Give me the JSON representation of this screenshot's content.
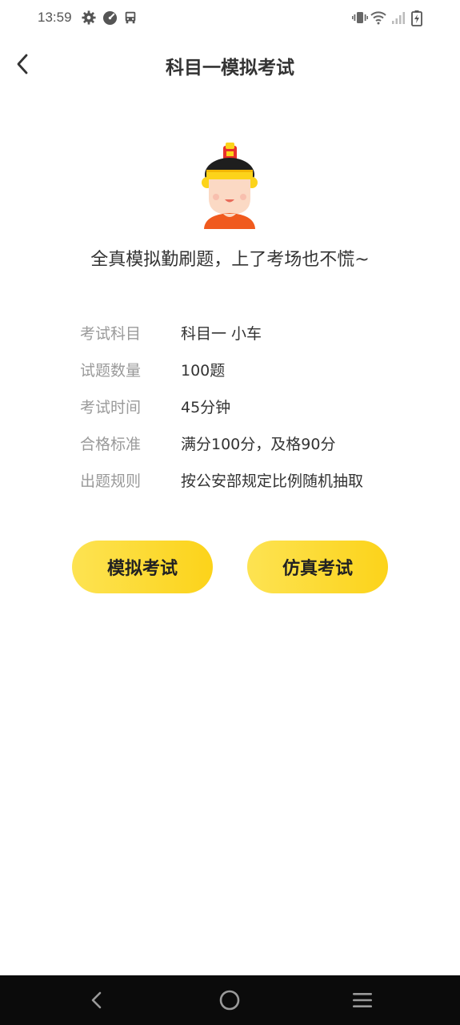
{
  "status_bar": {
    "time": "13:59",
    "left_icons": [
      "gear-icon",
      "speedometer-icon",
      "car-icon"
    ],
    "right_icons": [
      "vibrate-icon",
      "wifi-icon",
      "signal-icon",
      "battery-charging-icon"
    ]
  },
  "header": {
    "title": "科目一模拟考试",
    "back_icon": "chevron-left-icon"
  },
  "hero": {
    "slogan": "全真模拟勤刷题，上了考场也不慌~"
  },
  "exam_info": [
    {
      "label": "考试科目",
      "value": "科目一 小车"
    },
    {
      "label": "试题数量",
      "value": "100题"
    },
    {
      "label": "考试时间",
      "value": "45分钟"
    },
    {
      "label": "合格标准",
      "value": "满分100分，及格90分"
    },
    {
      "label": "出题规则",
      "value": "按公安部规定比例随机抽取"
    }
  ],
  "actions": {
    "mock_exam": "模拟考试",
    "simulation_exam": "仿真考试"
  },
  "system_nav": {
    "icons": [
      "nav-back-icon",
      "nav-home-icon",
      "nav-menu-icon"
    ]
  },
  "colors": {
    "accent": "#fcd31a",
    "accent_light": "#fde352",
    "nav_bar": "#0b0b0b",
    "text_primary": "#333333",
    "text_secondary": "#9a9a9a"
  }
}
